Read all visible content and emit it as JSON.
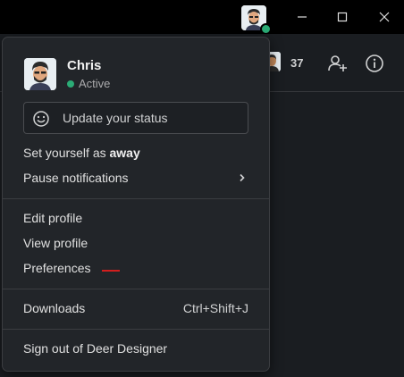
{
  "colors": {
    "titlebar_bg": "#000000",
    "app_bg": "#1a1d21",
    "menu_bg": "#222529",
    "presence_active": "#2bac76",
    "annotation_red": "#d21e1e"
  },
  "titlebar": {
    "avatar_icon": "user-avatar-icon",
    "controls": [
      "minimize-icon",
      "maximize-icon",
      "close-icon"
    ]
  },
  "header": {
    "member_count": "37",
    "add_people_icon": "add-user-icon",
    "details_icon": "info-icon"
  },
  "menu": {
    "user": {
      "name": "Chris",
      "status": "Active"
    },
    "status_placeholder": "Update your status",
    "away_prefix": "Set yourself as ",
    "away_emphasis": "away",
    "pause_notifications": "Pause notifications",
    "edit_profile": "Edit profile",
    "view_profile": "View profile",
    "preferences": "Preferences",
    "downloads": "Downloads",
    "downloads_shortcut": "Ctrl+Shift+J",
    "sign_out": "Sign out of Deer Designer"
  }
}
